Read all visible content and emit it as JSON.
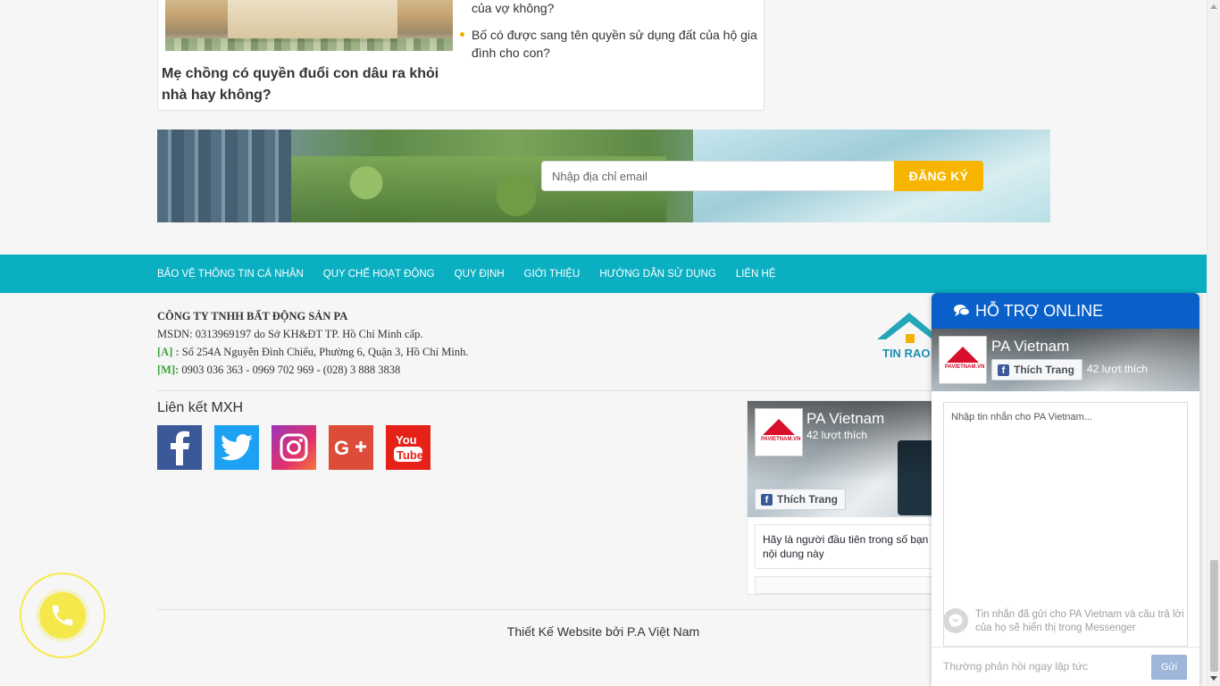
{
  "news": {
    "title": "Mẹ chồng có quyền đuổi con dâu ra khỏi nhà hay không?",
    "related": [
      "của vợ không?",
      "Bố có được sang tên quyền sử dụng đất của hộ gia đình cho con?"
    ]
  },
  "newsletter": {
    "email_placeholder": "Nhập địa chỉ email",
    "subscribe_label": "ĐĂNG KÝ"
  },
  "footer_nav": [
    "BẢO VỆ THÔNG TIN CÁ NHÂN",
    "QUY CHẾ HOẠT ĐỘNG",
    "QUY ĐỊNH",
    "GIỚI THIỆU",
    "HƯỚNG DẪN SỬ DỤNG",
    "LIÊN HỆ"
  ],
  "company": {
    "name": "CÔNG TY TNHH BẤT ĐỘNG SẢN PA",
    "msdn": "MSDN: 0313969197 do Sở KH&ĐT TP. Hồ Chí Minh cấp.",
    "address_label": "[A] :",
    "address": "Số 254A Nguyễn Đình Chiểu, Phường 6, Quận 3, Hồ Chí Minh.",
    "phone_label": "[M]:",
    "phone": "0903 036 363 - 0969 702 969 - (028) 3 888 3838"
  },
  "logo_text": "TIN RAO",
  "social": {
    "title": "Liên kết MXH",
    "icons": [
      "facebook-icon",
      "twitter-icon",
      "instagram-icon",
      "google-plus-icon",
      "youtube-icon"
    ]
  },
  "fb_page": {
    "name": "PA Vietnam",
    "likes": "42 lượt thích",
    "like_button": "Thích Trang",
    "avatar_text": "PAVIETNAM.VN",
    "post_text": "Hãy là người đầu tiên trong số bạn nội dung này"
  },
  "credit": "Thiết Kế Website bởi P.A Việt Nam",
  "chat": {
    "header": "HỖ TRỢ ONLINE",
    "page_name": "PA Vietnam",
    "like_button": "Thích Trang",
    "likes": "42 lượt thích",
    "input_placeholder": "Nhập tin nhắn cho PA Vietnam...",
    "note": "Tin nhắn đã gửi cho PA Vietnam và câu trả lời của họ sẽ hiển thị trong Messenger",
    "reply_hint": "Thường phản hồi ngay lập tức",
    "send_label": "Gửi"
  },
  "colors": {
    "nav_bg": "#0aafc2",
    "subscribe_bg": "#f7b500",
    "chat_header": "#0a60c9",
    "call_button": "#f5e84a",
    "label_green": "#3aa33a"
  }
}
